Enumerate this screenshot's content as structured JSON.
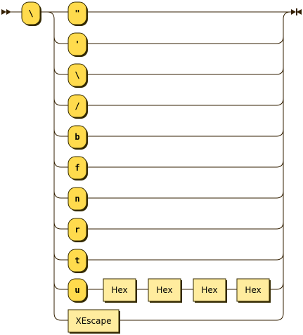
{
  "diagram": {
    "lead_terminal": "\\",
    "alternatives": [
      {
        "terminal": "\""
      },
      {
        "terminal": "'"
      },
      {
        "terminal": "\\"
      },
      {
        "terminal": "/"
      },
      {
        "terminal": "b"
      },
      {
        "terminal": "f"
      },
      {
        "terminal": "n"
      },
      {
        "terminal": "r"
      },
      {
        "terminal": "t"
      },
      {
        "terminal": "u",
        "followed_by": [
          "Hex",
          "Hex",
          "Hex",
          "Hex"
        ]
      },
      {
        "nonterminal": "XEscape"
      }
    ]
  },
  "colors": {
    "terminal_fill": "#ffdb4d",
    "nonterminal_fill": "#ffec9e",
    "stroke": "#331f00"
  }
}
